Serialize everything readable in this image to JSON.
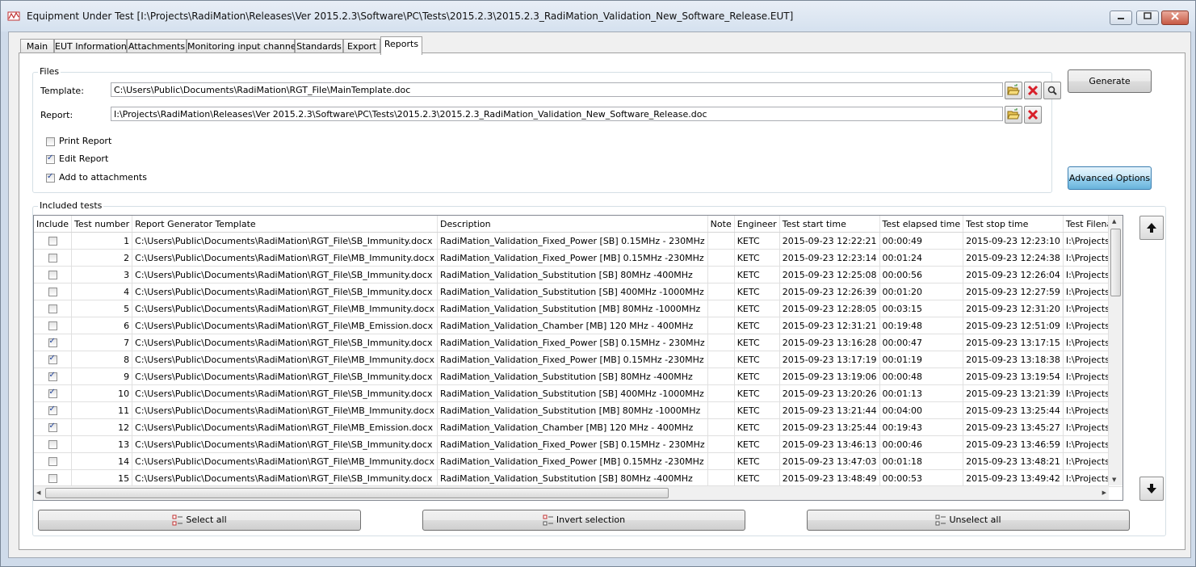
{
  "window": {
    "title": "Equipment Under Test [I:\\Projects\\RadiMation\\Releases\\Ver 2015.2.3\\Software\\PC\\Tests\\2015.2.3\\2015.2.3_RadiMation_Validation_New_Software_Release.EUT]"
  },
  "tabs": [
    "Main",
    "EUT Information",
    "Attachments",
    "Monitoring input channels",
    "Standards",
    "Export",
    "Reports"
  ],
  "active_tab": "Reports",
  "files": {
    "group_title": "Files",
    "template_label": "Template:",
    "template_value": "C:\\Users\\Public\\Documents\\RadiMation\\RGT_File\\MainTemplate.doc",
    "report_label": "Report:",
    "report_value": "I:\\Projects\\RadiMation\\Releases\\Ver 2015.2.3\\Software\\PC\\Tests\\2015.2.3\\2015.2.3_RadiMation_Validation_New_Software_Release.doc"
  },
  "options": {
    "print_report": {
      "label": "Print Report",
      "checked": false
    },
    "edit_report": {
      "label": "Edit Report",
      "checked": true
    },
    "add_attachments": {
      "label": "Add to attachments",
      "checked": true
    }
  },
  "buttons": {
    "generate": "Generate",
    "advanced_options": "Advanced Options",
    "select_all": "Select all",
    "invert_selection": "Invert selection",
    "unselect_all": "Unselect all"
  },
  "tests": {
    "group_title": "Included tests",
    "columns": [
      "Include",
      "Test number",
      "Report Generator Template",
      "Description",
      "Note",
      "Engineer",
      "Test start time",
      "Test elapsed time",
      "Test stop time",
      "Test Filename"
    ],
    "rows": [
      {
        "include": false,
        "number": "1",
        "template": "C:\\Users\\Public\\Documents\\RadiMation\\RGT_File\\SB_Immunity.docx",
        "description": "RadiMation_Validation_Fixed_Power [SB] 0.15MHz - 230MHz",
        "note": "",
        "engineer": "KETC",
        "start": "2015-09-23 12:22:21",
        "elapsed": "00:00:49",
        "stop": "2015-09-23 12:23:10",
        "filename": "I:\\Projects\\RadiMation\\R"
      },
      {
        "include": false,
        "number": "2",
        "template": "C:\\Users\\Public\\Documents\\RadiMation\\RGT_File\\MB_Immunity.docx",
        "description": "RadiMation_Validation_Fixed_Power [MB] 0.15MHz -230MHz",
        "note": "",
        "engineer": "KETC",
        "start": "2015-09-23 12:23:14",
        "elapsed": "00:01:24",
        "stop": "2015-09-23 12:24:38",
        "filename": "I:\\Projects\\RadiMation\\R"
      },
      {
        "include": false,
        "number": "3",
        "template": "C:\\Users\\Public\\Documents\\RadiMation\\RGT_File\\SB_Immunity.docx",
        "description": "RadiMation_Validation_Substitution [SB] 80MHz -400MHz",
        "note": "",
        "engineer": "KETC",
        "start": "2015-09-23 12:25:08",
        "elapsed": "00:00:56",
        "stop": "2015-09-23 12:26:04",
        "filename": "I:\\Projects\\RadiMation\\R"
      },
      {
        "include": false,
        "number": "4",
        "template": "C:\\Users\\Public\\Documents\\RadiMation\\RGT_File\\SB_Immunity.docx",
        "description": "RadiMation_Validation_Substitution [SB] 400MHz -1000MHz",
        "note": "",
        "engineer": "KETC",
        "start": "2015-09-23 12:26:39",
        "elapsed": "00:01:20",
        "stop": "2015-09-23 12:27:59",
        "filename": "I:\\Projects\\RadiMation\\R"
      },
      {
        "include": false,
        "number": "5",
        "template": "C:\\Users\\Public\\Documents\\RadiMation\\RGT_File\\MB_Immunity.docx",
        "description": "RadiMation_Validation_Substitution [MB] 80MHz -1000MHz",
        "note": "",
        "engineer": "KETC",
        "start": "2015-09-23 12:28:05",
        "elapsed": "00:03:15",
        "stop": "2015-09-23 12:31:20",
        "filename": "I:\\Projects\\RadiMation\\R"
      },
      {
        "include": false,
        "number": "6",
        "template": "C:\\Users\\Public\\Documents\\RadiMation\\RGT_File\\MB_Emission.docx",
        "description": "RadiMation_Validation_Chamber [MB] 120 MHz - 400MHz",
        "note": "",
        "engineer": "KETC",
        "start": "2015-09-23 12:31:21",
        "elapsed": "00:19:48",
        "stop": "2015-09-23 12:51:09",
        "filename": "I:\\Projects\\RadiMation\\R"
      },
      {
        "include": true,
        "number": "7",
        "template": "C:\\Users\\Public\\Documents\\RadiMation\\RGT_File\\SB_Immunity.docx",
        "description": "RadiMation_Validation_Fixed_Power [SB] 0.15MHz - 230MHz",
        "note": "",
        "engineer": "KETC",
        "start": "2015-09-23 13:16:28",
        "elapsed": "00:00:47",
        "stop": "2015-09-23 13:17:15",
        "filename": "I:\\Projects\\RadiMation\\R"
      },
      {
        "include": true,
        "number": "8",
        "template": "C:\\Users\\Public\\Documents\\RadiMation\\RGT_File\\MB_Immunity.docx",
        "description": "RadiMation_Validation_Fixed_Power [MB] 0.15MHz -230MHz",
        "note": "",
        "engineer": "KETC",
        "start": "2015-09-23 13:17:19",
        "elapsed": "00:01:19",
        "stop": "2015-09-23 13:18:38",
        "filename": "I:\\Projects\\RadiMation\\R"
      },
      {
        "include": true,
        "number": "9",
        "template": "C:\\Users\\Public\\Documents\\RadiMation\\RGT_File\\SB_Immunity.docx",
        "description": "RadiMation_Validation_Substitution [SB] 80MHz -400MHz",
        "note": "",
        "engineer": "KETC",
        "start": "2015-09-23 13:19:06",
        "elapsed": "00:00:48",
        "stop": "2015-09-23 13:19:54",
        "filename": "I:\\Projects\\RadiMation\\R"
      },
      {
        "include": true,
        "number": "10",
        "template": "C:\\Users\\Public\\Documents\\RadiMation\\RGT_File\\SB_Immunity.docx",
        "description": "RadiMation_Validation_Substitution [SB] 400MHz -1000MHz",
        "note": "",
        "engineer": "KETC",
        "start": "2015-09-23 13:20:26",
        "elapsed": "00:01:13",
        "stop": "2015-09-23 13:21:39",
        "filename": "I:\\Projects\\RadiMation\\R"
      },
      {
        "include": true,
        "number": "11",
        "template": "C:\\Users\\Public\\Documents\\RadiMation\\RGT_File\\MB_Immunity.docx",
        "description": "RadiMation_Validation_Substitution [MB] 80MHz -1000MHz",
        "note": "",
        "engineer": "KETC",
        "start": "2015-09-23 13:21:44",
        "elapsed": "00:04:00",
        "stop": "2015-09-23 13:25:44",
        "filename": "I:\\Projects\\RadiMation\\R"
      },
      {
        "include": true,
        "number": "12",
        "template": "C:\\Users\\Public\\Documents\\RadiMation\\RGT_File\\MB_Emission.docx",
        "description": "RadiMation_Validation_Chamber [MB] 120 MHz - 400MHz",
        "note": "",
        "engineer": "KETC",
        "start": "2015-09-23 13:25:44",
        "elapsed": "00:19:43",
        "stop": "2015-09-23 13:45:27",
        "filename": "I:\\Projects\\RadiMation\\R"
      },
      {
        "include": false,
        "number": "13",
        "template": "C:\\Users\\Public\\Documents\\RadiMation\\RGT_File\\SB_Immunity.docx",
        "description": "RadiMation_Validation_Fixed_Power [SB] 0.15MHz - 230MHz",
        "note": "",
        "engineer": "KETC",
        "start": "2015-09-23 13:46:13",
        "elapsed": "00:00:46",
        "stop": "2015-09-23 13:46:59",
        "filename": "I:\\Projects\\RadiMation\\R"
      },
      {
        "include": false,
        "number": "14",
        "template": "C:\\Users\\Public\\Documents\\RadiMation\\RGT_File\\MB_Immunity.docx",
        "description": "RadiMation_Validation_Fixed_Power [MB] 0.15MHz -230MHz",
        "note": "",
        "engineer": "KETC",
        "start": "2015-09-23 13:47:03",
        "elapsed": "00:01:18",
        "stop": "2015-09-23 13:48:21",
        "filename": "I:\\Projects\\RadiMation\\R"
      },
      {
        "include": false,
        "number": "15",
        "template": "C:\\Users\\Public\\Documents\\RadiMation\\RGT_File\\SB_Immunity.docx",
        "description": "RadiMation_Validation_Substitution [SB] 80MHz -400MHz",
        "note": "",
        "engineer": "KETC",
        "start": "2015-09-23 13:48:49",
        "elapsed": "00:00:53",
        "stop": "2015-09-23 13:49:42",
        "filename": "I:\\Projects\\RadiMation\\R"
      }
    ]
  },
  "icons": {
    "app": "radimation-app-icon",
    "open_folder": "open-folder-icon",
    "delete": "red-x-icon",
    "view": "magnifier-icon",
    "move_up": "arrow-up-icon",
    "move_down": "arrow-down-icon"
  },
  "colors": {
    "delete_red": "#d8202a",
    "accent_blue": "#68b3db",
    "checkmark": "#21449c"
  }
}
